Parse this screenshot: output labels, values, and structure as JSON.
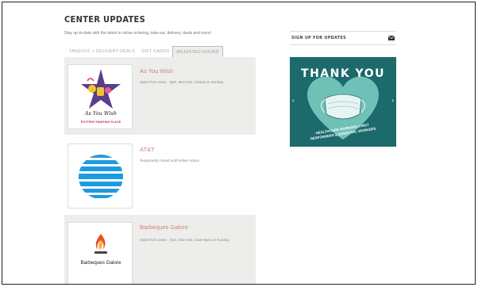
{
  "page": {
    "title": "CENTER UPDATES",
    "subtitle": "Stay up-to-date with the latest in online ordering, take-out, delivery, deals and more!"
  },
  "tabs": [
    {
      "label": "TAKEOUT + DELIVERY DEALS",
      "active": false
    },
    {
      "label": "GIFT CARDS",
      "active": false
    },
    {
      "label": "ADJUSTED HOURS",
      "active": true
    }
  ],
  "listings": [
    {
      "name": "As You Wish",
      "hours": "Open from 11am - 4pm, Mon-Sat. Closed on Sunday.",
      "logo_top": "As You Wish",
      "logo_bottom": "POTTERY PAINTING PLACE"
    },
    {
      "name": "AT&T",
      "hours": "Temporarily closed until further notice."
    },
    {
      "name": "Barbeques Galore",
      "hours": "Open from 10am - 7pm, Mon-Sat, 11am-6pm on Sunday.",
      "logo_text": "Barbeques Galore"
    }
  ],
  "sidebar": {
    "signup_label": "SIGN UP FOR UPDATES",
    "banner": {
      "headline": "THANK YOU",
      "line1": "HEALTHCARE WORKERS, FIRST",
      "line2": "RESPONDERS & ESSENTIAL WORKERS"
    }
  },
  "colors": {
    "accent_link": "#d4827a",
    "panel_bg": "#ededeb",
    "banner_bg": "#1c6a6c",
    "heart": "#6fc1b8"
  },
  "icons": [
    "envelope-icon",
    "chevron-left-icon",
    "chevron-right-icon",
    "face-mask-icon"
  ]
}
